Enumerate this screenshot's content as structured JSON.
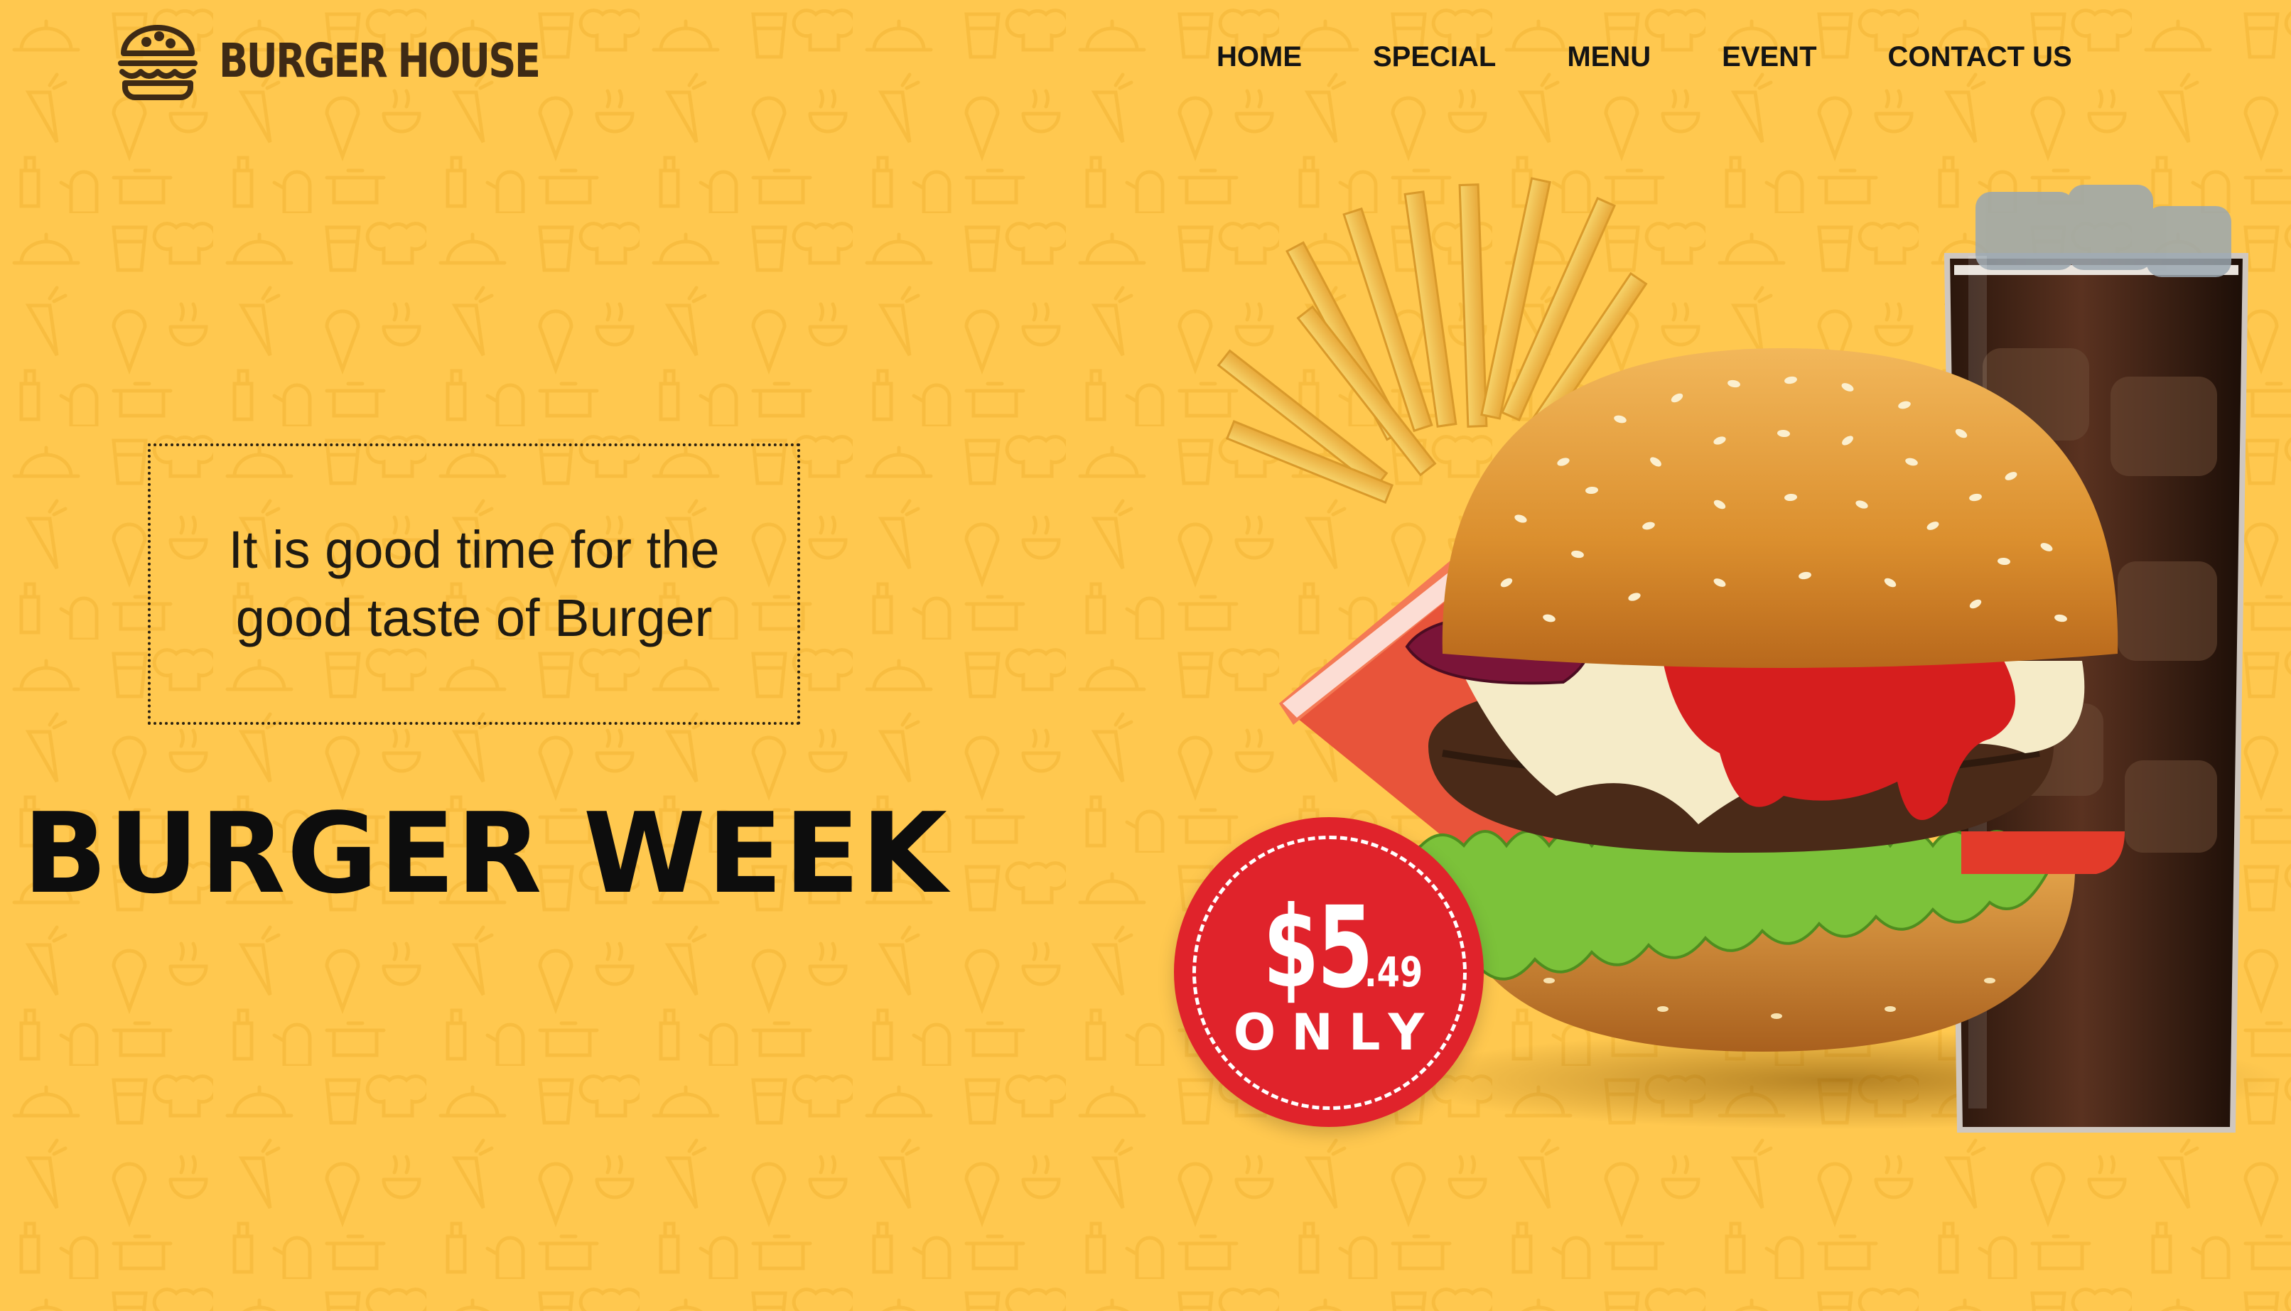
{
  "brand": {
    "name": "BURGER HOUSE",
    "logo_icon": "burger-icon"
  },
  "nav": {
    "items": [
      {
        "label": "HOME"
      },
      {
        "label": "SPECIAL"
      },
      {
        "label": "MENU"
      },
      {
        "label": "EVENT"
      },
      {
        "label": "CONTACT US"
      }
    ]
  },
  "hero": {
    "tagline": "It is good time for the good taste of Burger",
    "headline": "BURGER WEEK",
    "price": {
      "dollars": "$5",
      "cents": ".49",
      "suffix": "ONLY"
    }
  },
  "colors": {
    "background": "#FFC84F",
    "badge": "#E0232B",
    "text_dark": "#0d0d0d",
    "logo_brown": "#3E2A15"
  }
}
